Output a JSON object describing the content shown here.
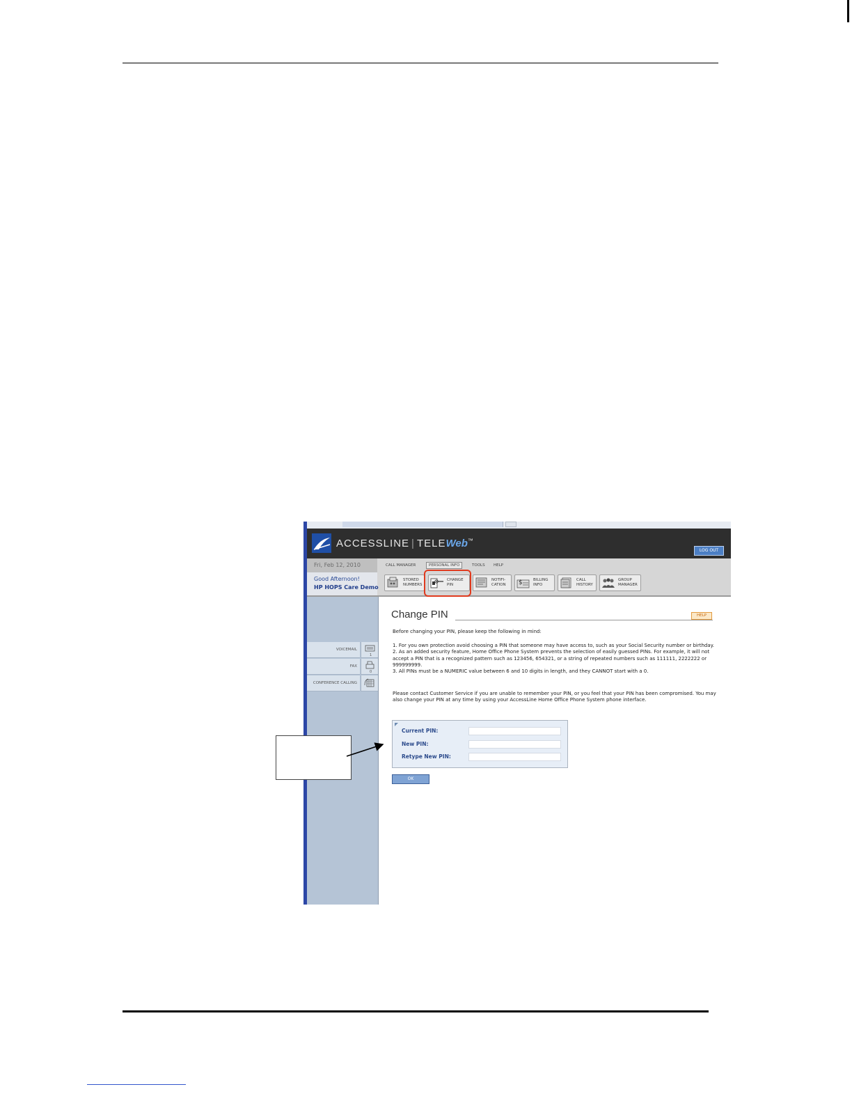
{
  "brand": {
    "name": "ACCESSLINE",
    "product_prefix": "TELE",
    "product_suffix": "Web",
    "trademark": "™"
  },
  "header": {
    "logout_label": "LOG OUT"
  },
  "date": "Fri, Feb 12, 2010",
  "greeting": "Good Afternoon!",
  "user": "HP HOPS Care Demo",
  "menu": [
    "CALL MANAGER",
    "PERSONAL INFO",
    "TOOLS",
    "HELP"
  ],
  "toolbar": [
    {
      "line1": "STORED",
      "line2": "NUMBERS",
      "icon": "stored-numbers-icon"
    },
    {
      "line1": "CHANGE",
      "line2": "PIN",
      "icon": "change-pin-icon"
    },
    {
      "line1": "NOTIFI-",
      "line2": "CATION",
      "icon": "notification-icon"
    },
    {
      "line1": "BILLING",
      "line2": "INFO",
      "icon": "billing-icon"
    },
    {
      "line1": "CALL",
      "line2": "HISTORY",
      "icon": "call-history-icon"
    },
    {
      "line1": "GROUP",
      "line2": "MANAGER",
      "icon": "group-manager-icon"
    }
  ],
  "sidebar": [
    {
      "label": "VOICEMAIL",
      "count": "1",
      "icon": "voicemail-icon"
    },
    {
      "label": "FAX",
      "count": "0",
      "icon": "fax-icon"
    },
    {
      "label": "CONFERENCE CALLING",
      "count": "",
      "icon": "conference-icon"
    }
  ],
  "page": {
    "title": "Change PIN",
    "help_label": "HELP",
    "intro": "Before changing your PIN, please keep the following in mind:",
    "rules": "1. For you own protection avoid choosing a PIN that someone may have access to, such as your Social Security number or birthday.\n2. As an added security feature, Home Office Phone System prevents the selection of easily guessed PINs. For example, it will not accept a PIN that is a recognized pattern such as 123456, 654321, or a string of repeated numbers such as 111111, 2222222 or 999999999.\n3. All PINs must be a NUMERIC value between 6 and 10 digits in length, and they CANNOT start with a 0.",
    "contact": "Please contact Customer Service if you are unable to remember your PIN, or you feel that your PIN has been compromised. You may also change your PIN at any time by using your AccessLine Home Office Phone System phone interface."
  },
  "form": {
    "current_pin_label": "Current PIN:",
    "new_pin_label": "New PIN:",
    "retype_pin_label": "Retype New PIN:",
    "current_pin_value": "",
    "new_pin_value": "",
    "retype_pin_value": "",
    "ok_label": "OK"
  }
}
